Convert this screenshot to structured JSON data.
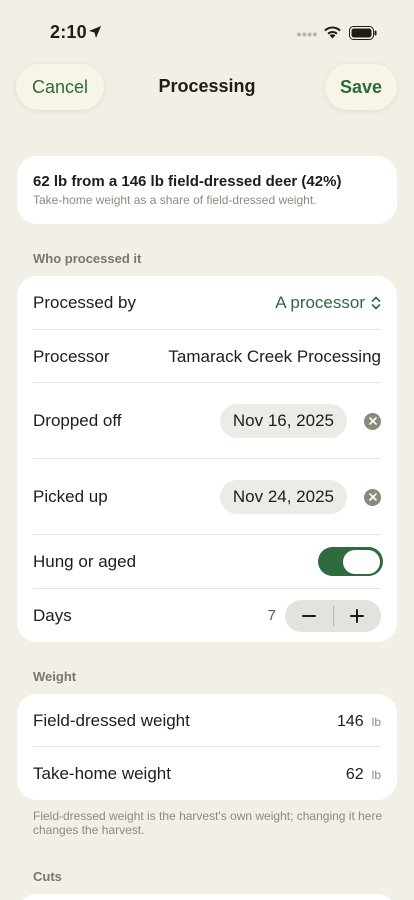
{
  "status": {
    "time": "2:10"
  },
  "nav": {
    "cancel": "Cancel",
    "title": "Processing",
    "save": "Save"
  },
  "summary": {
    "title": "62 lb from a 146 lb field-dressed deer (42%)",
    "subtitle": "Take-home weight as a share of field-dressed weight."
  },
  "who": {
    "header": "Who processed it",
    "processed_by_label": "Processed by",
    "processed_by_value": "A processor",
    "processor_label": "Processor",
    "processor_value": "Tamarack Creek Processing",
    "dropped_off_label": "Dropped off",
    "dropped_off_value": "Nov 16, 2025",
    "picked_up_label": "Picked up",
    "picked_up_value": "Nov 24, 2025",
    "hung_label": "Hung or aged",
    "hung_on": true,
    "days_label": "Days",
    "days_value": "7"
  },
  "weight": {
    "header": "Weight",
    "field_dressed_label": "Field-dressed weight",
    "field_dressed_value": "146",
    "field_dressed_unit": "lb",
    "take_home_label": "Take-home weight",
    "take_home_value": "62",
    "take_home_unit": "lb",
    "footnote": "Field-dressed weight is the harvest's own weight; changing it here changes the harvest."
  },
  "cuts": {
    "header": "Cuts"
  },
  "colors": {
    "accent": "#2b6a3f",
    "background": "#f2efe6"
  }
}
